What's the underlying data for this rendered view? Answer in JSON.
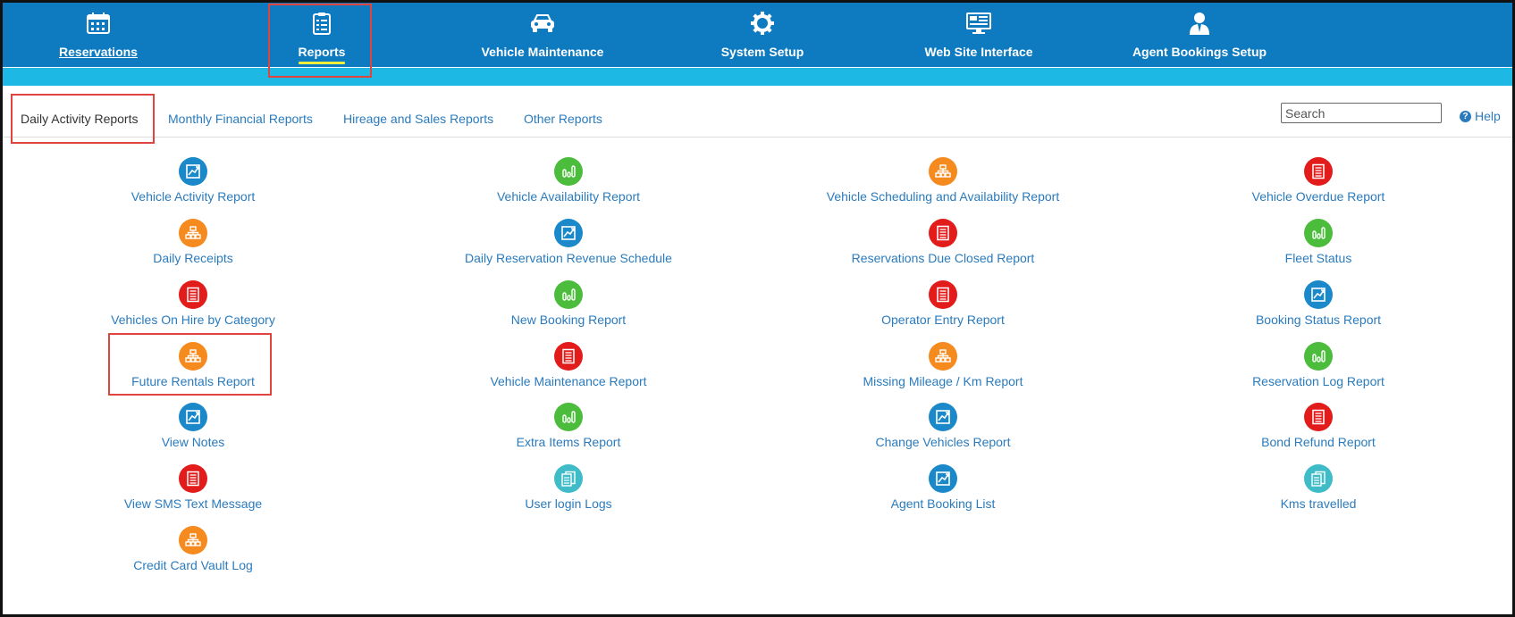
{
  "nav": {
    "items": [
      {
        "label": "Reservations",
        "icon": "calendar-icon"
      },
      {
        "label": "Reports",
        "icon": "clipboard-list-icon"
      },
      {
        "label": "Vehicle Maintenance",
        "icon": "car-icon"
      },
      {
        "label": "System Setup",
        "icon": "gear-icon"
      },
      {
        "label": "Web Site Interface",
        "icon": "monitor-icon"
      },
      {
        "label": "Agent Bookings Setup",
        "icon": "user-tie-icon"
      }
    ],
    "active": "Reports"
  },
  "tabs": {
    "items": [
      "Daily Activity Reports",
      "Monthly Financial Reports",
      "Hireage and Sales Reports",
      "Other Reports"
    ],
    "active": "Daily Activity Reports"
  },
  "search": {
    "placeholder": "Search"
  },
  "help": {
    "label": "Help"
  },
  "colors": {
    "nav_bg": "#0e7bc0",
    "sub_bar": "#1db8e3",
    "link": "#2a7bbd",
    "highlight": "#e0443e",
    "blue": "#1a88c9",
    "green": "#4cbc3c",
    "orange": "#f58a1f",
    "red": "#e21b1b",
    "teal": "#3fbcc7"
  },
  "reports": {
    "columns": [
      [
        {
          "label": "Vehicle Activity Report",
          "icon": "chart-line-icon",
          "color": "blue"
        },
        {
          "label": "Daily Receipts",
          "icon": "sitemap-icon",
          "color": "orange"
        },
        {
          "label": "Vehicles On Hire by Category",
          "icon": "document-icon",
          "color": "red"
        },
        {
          "label": "Future Rentals Report",
          "icon": "sitemap-icon",
          "color": "orange"
        },
        {
          "label": "View Notes",
          "icon": "chart-line-icon",
          "color": "blue"
        },
        {
          "label": "View SMS Text Message",
          "icon": "document-icon",
          "color": "red"
        },
        {
          "label": "Credit Card Vault Log",
          "icon": "sitemap-icon",
          "color": "orange"
        }
      ],
      [
        {
          "label": "Vehicle Availability Report",
          "icon": "bar-chart-icon",
          "color": "green"
        },
        {
          "label": "Daily Reservation Revenue Schedule",
          "icon": "chart-line-icon",
          "color": "blue"
        },
        {
          "label": "New Booking Report",
          "icon": "bar-chart-icon",
          "color": "green"
        },
        {
          "label": "Vehicle Maintenance Report",
          "icon": "document-icon",
          "color": "red"
        },
        {
          "label": "Extra Items Report",
          "icon": "bar-chart-icon",
          "color": "green"
        },
        {
          "label": "User login Logs",
          "icon": "documents-icon",
          "color": "teal"
        }
      ],
      [
        {
          "label": "Vehicle Scheduling and Availability Report",
          "icon": "sitemap-icon",
          "color": "orange"
        },
        {
          "label": "Reservations Due Closed Report",
          "icon": "document-icon",
          "color": "red"
        },
        {
          "label": "Operator Entry Report",
          "icon": "document-icon",
          "color": "red"
        },
        {
          "label": "Missing Mileage / Km Report",
          "icon": "sitemap-icon",
          "color": "orange"
        },
        {
          "label": "Change Vehicles Report",
          "icon": "chart-line-icon",
          "color": "blue"
        },
        {
          "label": "Agent Booking List",
          "icon": "chart-line-icon",
          "color": "blue"
        }
      ],
      [
        {
          "label": "Vehicle Overdue Report",
          "icon": "document-icon",
          "color": "red"
        },
        {
          "label": "Fleet Status",
          "icon": "bar-chart-icon",
          "color": "green"
        },
        {
          "label": "Booking Status Report",
          "icon": "chart-line-icon",
          "color": "blue"
        },
        {
          "label": "Reservation Log Report",
          "icon": "bar-chart-icon",
          "color": "green"
        },
        {
          "label": "Bond Refund Report",
          "icon": "document-icon",
          "color": "red"
        },
        {
          "label": "Kms travelled",
          "icon": "documents-icon",
          "color": "teal"
        }
      ]
    ]
  }
}
